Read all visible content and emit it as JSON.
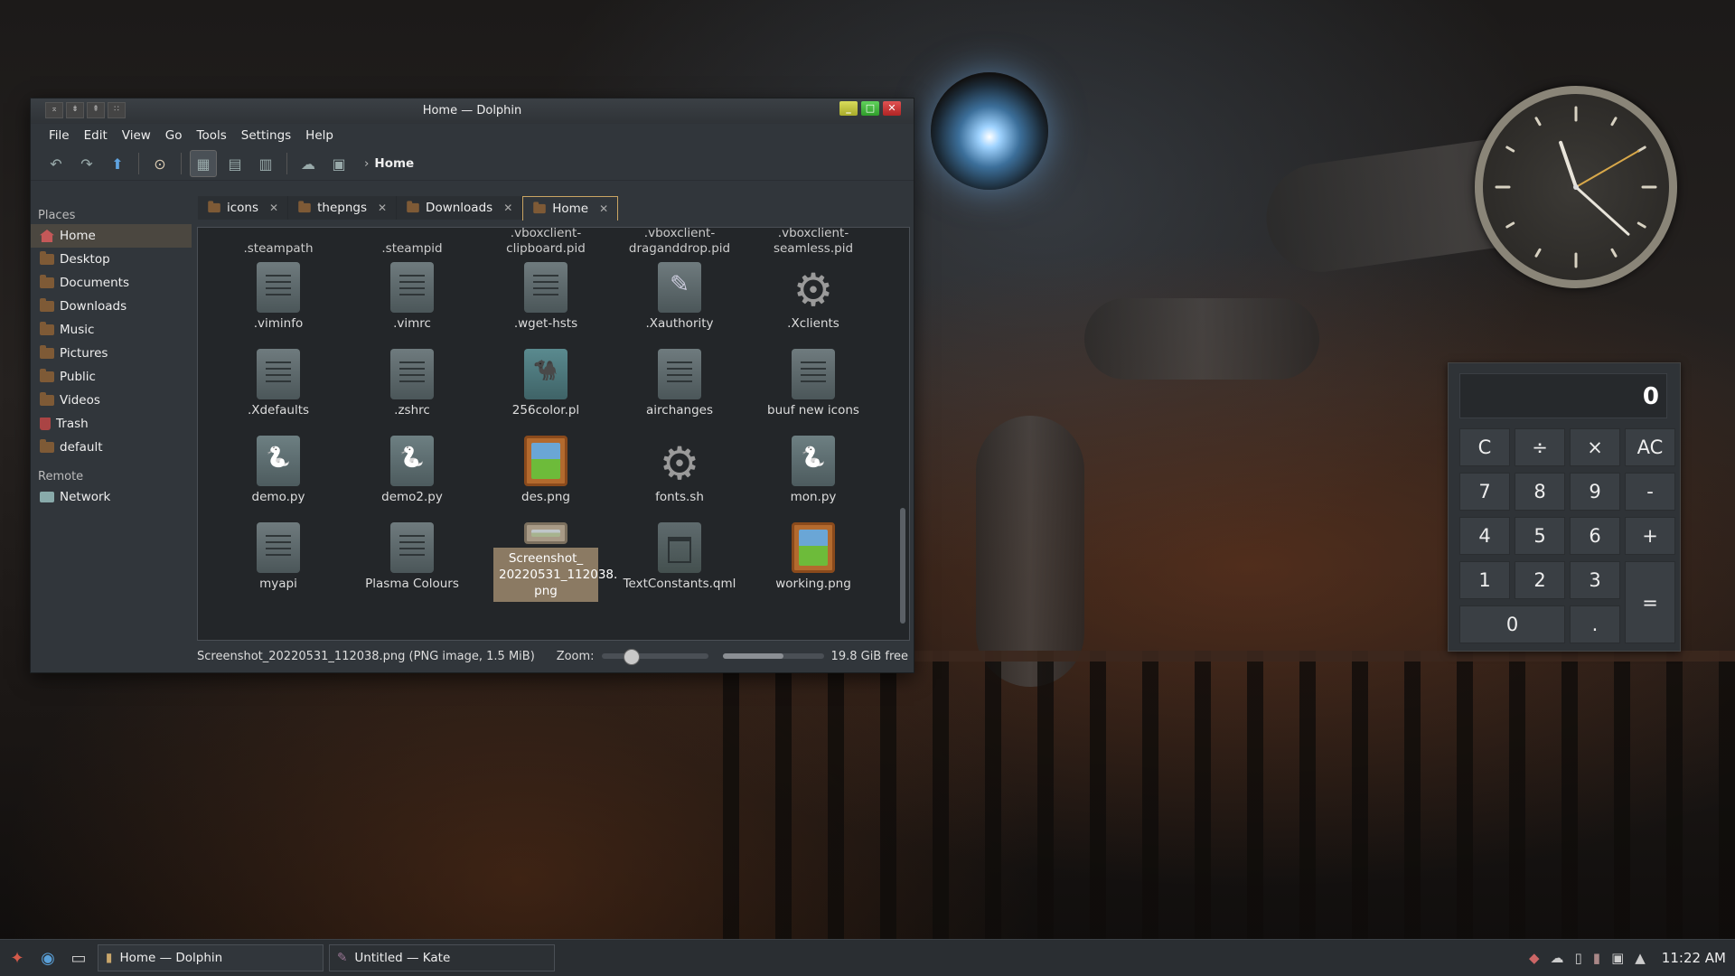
{
  "window": {
    "title": "Home — Dolphin",
    "menu": [
      "File",
      "Edit",
      "View",
      "Go",
      "Tools",
      "Settings",
      "Help"
    ],
    "breadcrumb": "Home"
  },
  "sidebar": {
    "places_label": "Places",
    "places": [
      "Home",
      "Desktop",
      "Documents",
      "Downloads",
      "Music",
      "Pictures",
      "Public",
      "Videos",
      "Trash",
      "default"
    ],
    "remote_label": "Remote",
    "remote": [
      "Network"
    ]
  },
  "tabs": [
    "icons",
    "thepngs",
    "Downloads",
    "Home"
  ],
  "partial_row": [
    ".steampath",
    ".steampid",
    ".vboxclient-\nclipboard.pid",
    ".vboxclient-\ndraganddrop.pid",
    ".vboxclient-\nseamless.pid"
  ],
  "files": [
    {
      "name": ".viminfo",
      "icon": "document-icon"
    },
    {
      "name": ".vimrc",
      "icon": "document-icon"
    },
    {
      "name": ".wget-hsts",
      "icon": "document-icon"
    },
    {
      "name": ".Xauthority",
      "icon": "auth-file-icon"
    },
    {
      "name": ".Xclients",
      "icon": "gear-icon"
    },
    {
      "name": ".Xdefaults",
      "icon": "document-icon"
    },
    {
      "name": ".zshrc",
      "icon": "document-icon"
    },
    {
      "name": "256color.pl",
      "icon": "perl-icon"
    },
    {
      "name": "airchanges",
      "icon": "document-icon"
    },
    {
      "name": "buuf new icons",
      "icon": "document-icon"
    },
    {
      "name": "demo.py",
      "icon": "python-icon"
    },
    {
      "name": "demo2.py",
      "icon": "python-icon"
    },
    {
      "name": "des.png",
      "icon": "image-icon"
    },
    {
      "name": "fonts.sh",
      "icon": "gear-icon"
    },
    {
      "name": "mon.py",
      "icon": "python-icon"
    },
    {
      "name": "myapi",
      "icon": "document-icon"
    },
    {
      "name": "Plasma Colours",
      "icon": "document-icon"
    },
    {
      "name": "Screenshot_\n20220531_112038.\npng",
      "icon": "image-icon"
    },
    {
      "name": "TextConstants.qml",
      "icon": "qml-icon"
    },
    {
      "name": "working.png",
      "icon": "image-icon"
    }
  ],
  "status": {
    "text": "Screenshot_20220531_112038.png (PNG image, 1.5 MiB)",
    "zoom_label": "Zoom:",
    "free_space": "19.8 GiB free",
    "used_fraction": 0.6
  },
  "calculator": {
    "display": "0",
    "keys": [
      "C",
      "÷",
      "×",
      "AC",
      "7",
      "8",
      "9",
      "-",
      "4",
      "5",
      "6",
      "+",
      "1",
      "2",
      "3",
      "=",
      "0",
      "."
    ]
  },
  "clock": {
    "time": "11:22 AM"
  },
  "taskbar": {
    "tasks": [
      "Home — Dolphin",
      "Untitled  — Kate"
    ],
    "time": "11:22 AM"
  }
}
